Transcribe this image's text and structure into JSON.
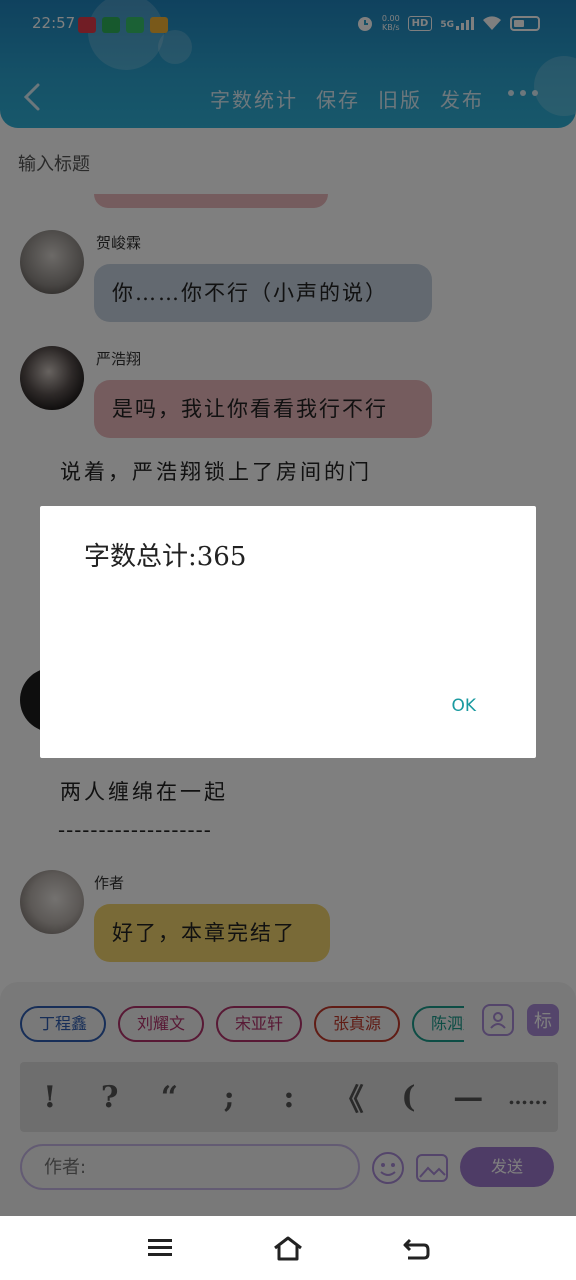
{
  "status_bar": {
    "time": "22:57",
    "net_speed_top": "0.00",
    "net_speed_unit": "KB/s",
    "hd": "HD",
    "network": "5G"
  },
  "toolbar": {
    "word_count": "字数统计",
    "save": "保存",
    "old_version": "旧版",
    "publish": "发布"
  },
  "title_placeholder": "输入标题",
  "messages": [
    {
      "name": "贺峻霖",
      "text": "你……你不行（小声的说）",
      "bubble_color": "#c7d2e0"
    },
    {
      "name": "严浩翔",
      "text": "是吗，我让你看看我行不行",
      "bubble_color": "#ebb8bd"
    }
  ],
  "narration": {
    "line1": "说着，严浩翔锁上了房间的门",
    "line2": "两人缠绵在一起",
    "divider": "-------------------"
  },
  "author_message": {
    "name": "作者",
    "text": "好了，本章完结了",
    "bubble_color": "#f2d56e"
  },
  "dialog": {
    "message": "字数总计:365",
    "ok_label": "OK"
  },
  "role_chips": [
    {
      "label": "丁程鑫",
      "color": "#2f5db0"
    },
    {
      "label": "刘耀文",
      "color": "#b0326a"
    },
    {
      "label": "宋亚轩",
      "color": "#b0326a"
    },
    {
      "label": "张真源",
      "color": "#c0392b"
    },
    {
      "label": "陈泗旭",
      "color": "#1a9a8a"
    }
  ],
  "side_buttons": {
    "mark_label": "标"
  },
  "punctuation": [
    "!",
    "?",
    "“",
    ";",
    ":",
    "《",
    "(",
    "—",
    "……"
  ],
  "author_input": {
    "placeholder": "作者:"
  },
  "send_label": "发送"
}
